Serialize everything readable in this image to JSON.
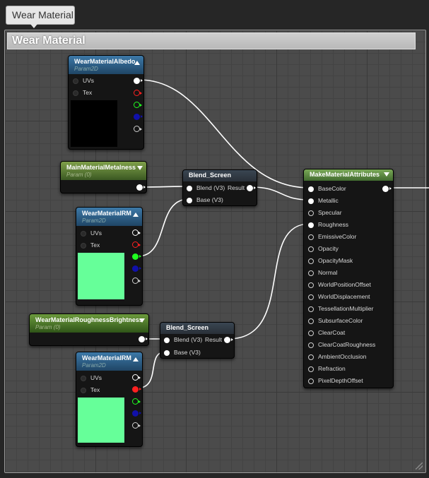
{
  "tab": {
    "label": "Wear Material"
  },
  "frame": {
    "title": "Wear Material"
  },
  "nodes": {
    "albedo": {
      "title": "WearMaterialAlbedo",
      "subtitle": "Param2D",
      "pins": [
        "UVs",
        "Tex"
      ]
    },
    "metalness": {
      "title": "MainMaterialMetalness",
      "subtitle": "Param (0)"
    },
    "rm1": {
      "title": "WearMaterialRM",
      "subtitle": "Param2D",
      "pins": [
        "UVs",
        "Tex"
      ]
    },
    "roughness": {
      "title": "WearMaterialRoughnessBrightness",
      "subtitle": "Param (0)"
    },
    "rm2": {
      "title": "WearMaterialRM",
      "subtitle": "Param2D",
      "pins": [
        "UVs",
        "Tex"
      ]
    },
    "blend1": {
      "title": "Blend_Screen",
      "inputs": [
        "Blend (V3)",
        "Base (V3)"
      ],
      "output": "Result"
    },
    "blend2": {
      "title": "Blend_Screen",
      "inputs": [
        "Blend (V3)",
        "Base (V3)"
      ],
      "output": "Result"
    },
    "mma": {
      "title": "MakeMaterialAttributes",
      "inputs": [
        "BaseColor",
        "Metallic",
        "Specular",
        "Roughness",
        "EmissiveColor",
        "Opacity",
        "OpacityMask",
        "Normal",
        "WorldPositionOffset",
        "WorldDisplacement",
        "TessellationMultiplier",
        "SubsurfaceColor",
        "ClearCoat",
        "ClearCoatRoughness",
        "AmbientOcclusion",
        "Refraction",
        "PixelDepthOffset"
      ]
    }
  },
  "colors": {
    "background": "#4b4b4b",
    "node_body": "#151515",
    "texture_black": "#000000",
    "texture_green": "#66ff99",
    "pin_red": "#ff2020",
    "pin_green": "#20ff20",
    "pin_blue": "#2020ff"
  }
}
